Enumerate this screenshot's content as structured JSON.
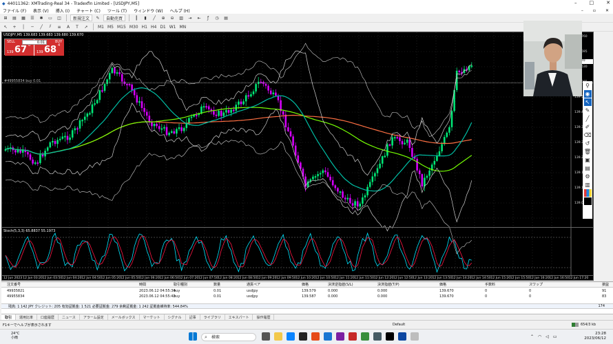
{
  "window": {
    "title": "44011362: XMTrading-Real 34 - Tradexfin Limited - [USDJPY,M5]"
  },
  "menu": [
    "ファイル (F)",
    "表示 (V)",
    "挿入 (I)",
    "チャート (C)",
    "ツール (T)",
    "ウィンドウ (W)",
    "ヘルプ (H)"
  ],
  "toolbar": {
    "new_order": "新規注文",
    "auto_trading": "自動売買"
  },
  "timeframes": [
    "M1",
    "M5",
    "M15",
    "M30",
    "H1",
    "H4",
    "D1",
    "W1",
    "MN"
  ],
  "chart": {
    "header": "USDJPY,M5  139.683 139.683 139.680 139.670",
    "watermark": "#49955834 buy 0.01",
    "stoch_label": "Stoch(5,3,3) 65.8837 55.1973",
    "current_price": "139.670",
    "price_ticks": [
      "139.760",
      "139.695",
      "139.630",
      "139.565",
      "139.500",
      "139.445",
      "139.375",
      "139.310",
      "139.245",
      "139.185",
      "139.120",
      "139.055"
    ],
    "time_ticks": [
      "12 Jun 2023",
      "12 Jun 03:20",
      "12 Jun 03:50",
      "12 Jun 04:20",
      "12 Jun 04:50",
      "12 Jun 05:20",
      "12 Jun 05:50",
      "12 Jun 06:20",
      "12 Jun 06:50",
      "12 Jun 07:20",
      "12 Jun 07:50",
      "12 Jun 08:20",
      "12 Jun 08:50",
      "12 Jun 09:20",
      "12 Jun 09:50",
      "12 Jun 10:20",
      "12 Jun 10:50",
      "12 Jun 11:20",
      "12 Jun 11:50",
      "12 Jun 12:20",
      "12 Jun 12:50",
      "12 Jun 13:20",
      "12 Jun 13:50",
      "12 Jun 14:20",
      "12 Jun 14:50",
      "12 Jun 15:20",
      "12 Jun 15:50",
      "12 Jun 16:20",
      "12 Jun 16:50",
      "12 Jun 17:20"
    ],
    "colors": {
      "bull": "#00e676",
      "bear": "#d500f9",
      "ma1": "#00bfa5",
      "ma2": "#76ff03",
      "ma3": "#ff7043",
      "bands": "#d0d0d0",
      "stoch_main": "#00e5ff",
      "stoch_signal": "#ff1744"
    }
  },
  "trade_panel": {
    "sell_label": "SELL",
    "buy_label": "BUY",
    "lot": "0.01",
    "sell_prefix": "139",
    "sell_big": "67",
    "sell_sup": "0",
    "buy_prefix": "139",
    "buy_big": "68",
    "buy_sup": "4"
  },
  "terminal": {
    "headers": [
      "注文番号",
      "時間",
      "取引種別",
      "数量",
      "通貨ペア",
      "価格",
      "決済逆指値(S/L)",
      "決済指値(T/P)",
      "価格",
      "手数料",
      "スワップ",
      "損益"
    ],
    "rows": [
      [
        "49935821",
        "2023.06.12 04:55:34",
        "buy",
        "0.01",
        "usdjpy",
        "139.579",
        "0.000",
        "0.000",
        "139.670",
        "0",
        "0",
        "91"
      ],
      [
        "49955834",
        "2023.06.12 04:55:42",
        "buy",
        "0.01",
        "usdjpy",
        "139.587",
        "0.000",
        "0.000",
        "139.670",
        "0",
        "0",
        "83"
      ]
    ],
    "balance_line": "残高: 1 142 JPY  クレジット: 205  有効証拠金: 1 521  必要証拠金: 279  余剰証拠金: 1 242  証拠金維持率: 544.84%",
    "balance_total": "174",
    "tabs": [
      "取引",
      "運用比率",
      "口座履歴",
      "ニュース",
      "アラーム設定",
      "メールボックス",
      "マーケット",
      "シグナル",
      "記事",
      "ライブラリ",
      "エキスパート",
      "操作履歴"
    ]
  },
  "status": {
    "help": "F1キーでヘルプが表示されます",
    "profile": "Default",
    "traffic": "654/3 kb"
  },
  "taskbar": {
    "temp": "24°C",
    "weather": "小雨",
    "search": "検索",
    "time": "23:28",
    "date": "2023/06/12"
  }
}
